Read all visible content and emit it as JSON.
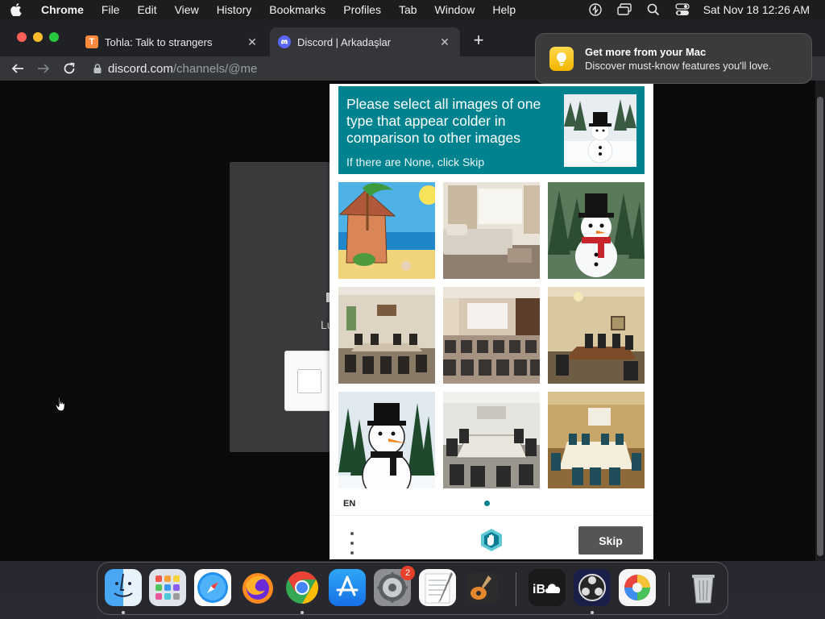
{
  "menubar": {
    "app_name": "Chrome",
    "items": [
      "File",
      "Edit",
      "View",
      "History",
      "Bookmarks",
      "Profiles",
      "Tab",
      "Window",
      "Help"
    ],
    "clock": "Sat Nov 18  12:26 AM"
  },
  "browser": {
    "tabs": [
      {
        "title": "Tohla: Talk to strangers",
        "favicon_letter": "T",
        "active": false
      },
      {
        "title": "Discord | Arkadaşlar",
        "favicon_letter": "",
        "active": true
      }
    ],
    "url_host": "discord.com",
    "url_path": "/channels/@me"
  },
  "background_page": {
    "fragment_text": "Lu"
  },
  "notification": {
    "title": "Get more from your Mac",
    "body": "Discover must-know features you'll love."
  },
  "captcha": {
    "prompt": "Please select all images of one type that appear colder in comparison to other images",
    "sub": "If there are None, click Skip",
    "example_image": "snowman",
    "tiles": [
      "beach-hut-painting",
      "living-room",
      "snowman-forest",
      "conference-room",
      "lecture-hall",
      "meeting-room",
      "snowman-cartoon",
      "boardroom",
      "banquet-room"
    ],
    "language": "EN",
    "skip_label": "Skip",
    "accent_color": "#00838f"
  },
  "dock": {
    "apps": [
      "finder",
      "launchpad",
      "safari",
      "firefox",
      "chrome",
      "app-store",
      "system-preferences",
      "textedit",
      "garageband",
      "icloud-ib",
      "obs",
      "color-app",
      "trash"
    ],
    "system_preferences_badge": "2"
  }
}
